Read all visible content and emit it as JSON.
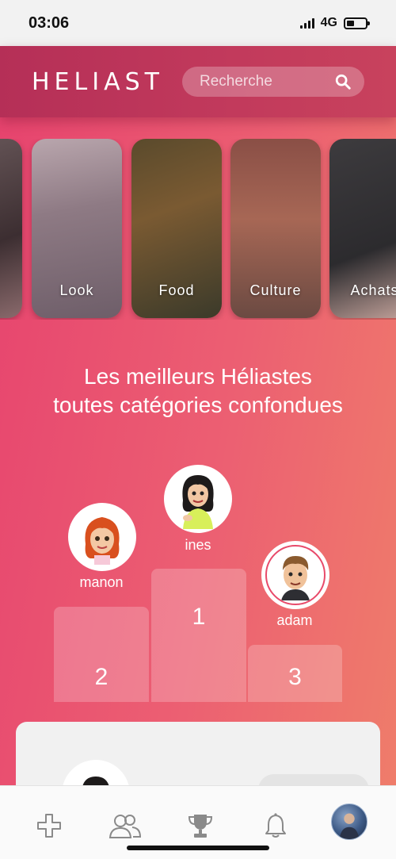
{
  "status_bar": {
    "time": "03:06",
    "network": "4G"
  },
  "header": {
    "logo": "HELIAST",
    "search_placeholder": "Recherche"
  },
  "categories": [
    {
      "label": "Look"
    },
    {
      "label": "Food"
    },
    {
      "label": "Culture"
    },
    {
      "label": "Achats"
    }
  ],
  "heading": {
    "line1": "Les meilleurs Héliastes",
    "line2": "toutes catégories confondues"
  },
  "podium": [
    {
      "rank": "1",
      "user": "ines"
    },
    {
      "rank": "2",
      "user": "manon"
    },
    {
      "rank": "3",
      "user": "adam"
    }
  ],
  "tabbar": {
    "icons": [
      "add-icon",
      "friends-icon",
      "trophy-icon",
      "bell-icon",
      "profile-avatar"
    ]
  },
  "colors": {
    "header": "#b52f57",
    "background_start": "#e6426e",
    "background_end": "#ef7e6a"
  }
}
